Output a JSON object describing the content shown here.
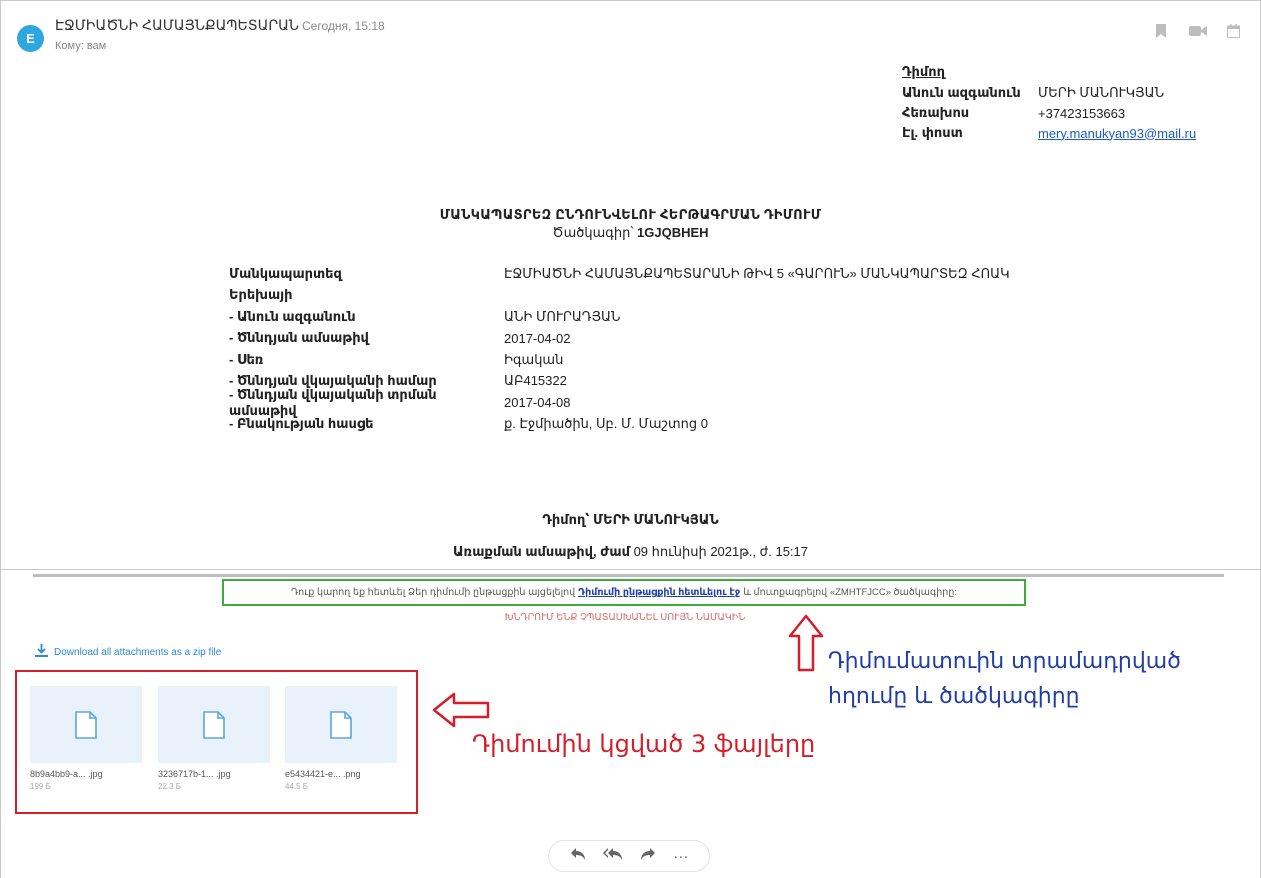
{
  "header": {
    "avatar_letter": "E",
    "sender": "ԷՋՄԻԱԾՆԻ ՀԱՄԱՅՆՔԱՊԵՏԱՐԱՆ",
    "date": "Сегодня, 15:18",
    "to": "Кому: вам",
    "icons": [
      "bookmark-icon",
      "video-icon",
      "calendar-icon"
    ]
  },
  "applicant": {
    "heading": "Դիմող",
    "rows": [
      {
        "label": "Անուն ազգանուն",
        "value": "ՄԵՐԻ ՄԱՆՈՒԿՅԱՆ"
      },
      {
        "label": "Հեռախոս",
        "value": "+37423153663"
      },
      {
        "label": "Էլ. փոստ",
        "value": "mery.manukyan93@mail.ru"
      }
    ]
  },
  "application": {
    "title": "ՄԱՆԿԱՊԱՏՐԵԶ ԸՆԴՈՒՆՎԵԼՈՒ ՀԵՐԹԱԳՐՄԱՆ ԴԻՄՈՒՄ",
    "code_label": "Ծածկագիր՝",
    "code": "1GJQBHEH",
    "rows": [
      {
        "label": "Մանկապարտեզ",
        "value": "ԷՋՄԻԱԾՆԻ ՀԱՄԱՅՆՔԱՊԵՏԱՐԱՆԻ ԹԻՎ 5 «ԳԱՐՈՒՆ» ՄԱՆԿԱՊԱՐՏԵԶ ՀՈԱԿ"
      },
      {
        "label": "Երեխայի",
        "value": ""
      },
      {
        "label": " - Անուն ազգանուն",
        "value": "ԱՆԻ ՄՈՒՐԱԴՅԱՆ"
      },
      {
        "label": " - Ծննդյան ամսաթիվ",
        "value": "2017-04-02"
      },
      {
        "label": " - Սեռ",
        "value": "Իգական"
      },
      {
        "label": " - Ծննդյան վկայականի համար",
        "value": "ԱԲ415322"
      },
      {
        "label": " - Ծննդյան վկայականի տրման ամսաթիվ",
        "value": "2017-04-08"
      },
      {
        "label": " - Բնակության հասցե",
        "value": "ք. Էջմիածին, Սբ. Մ. Մաշտոց 0"
      }
    ],
    "applicant_sign": "Դիմող՝ ՄԵՐԻ ՄԱՆՈՒԿՅԱՆ",
    "submitted_label": "Առաքման ամսաթիվ, ժամ",
    "submitted_value": "09 հունիսի 2021թ., ժ. 15:17"
  },
  "tracking": {
    "text_before": "Դուք կարող եք հետևել Ձեր դիմումի ընթացքին այցելելով",
    "link": "Դիմումի ընթացքին հետևելու էջ",
    "text_after": "և մուտքագրելով «ZMHTFJCC» ծածկագիրը:",
    "warning": "ԽՆԴՐՈՒՄ ԵՆՔ ՉՊԱՏԱՍԽԱՆԵԼ ՍՈՒՅՆ ՆԱՄԱԿԻՆ"
  },
  "attachments": {
    "download_label": "Download all attachments as a zip file",
    "files": [
      {
        "name": "8b9a4bb9-a... .jpg",
        "size": "199 Б"
      },
      {
        "name": "3236717b-1... .jpg",
        "size": "22.3 Б"
      },
      {
        "name": "e5434421-e... .png",
        "size": "44.5 Б"
      }
    ]
  },
  "annotations": {
    "files_note": "Դիմումին կցված 3 ֆայլերը",
    "link_note_line1": "Դիմումատուին տրամադրված",
    "link_note_line2": "հղումը և ծածկագիրը",
    "color_red": "#d41f2a",
    "color_green": "#3cac3c",
    "color_blue": "#1f3ea8"
  },
  "actions": {
    "reply": "↶",
    "reply_all": "«",
    "forward": "➡",
    "more": "···"
  }
}
